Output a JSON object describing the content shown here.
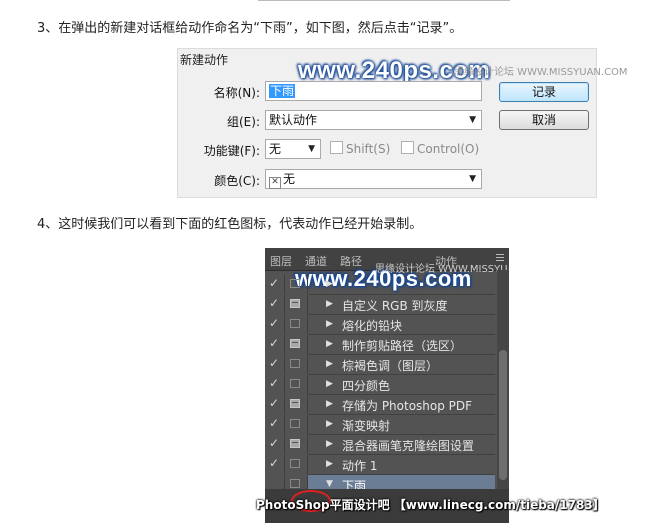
{
  "step3": {
    "text": "3、在弹出的新建对话框给动作命名为“下雨”，如下图，然后点击“记录”。"
  },
  "dialog": {
    "title": "新建动作",
    "watermark_main": "www.240ps.com",
    "watermark_sub": "思缘设计论坛  WWW.MISSYUAN.COM",
    "name_label": "名称(N):",
    "name_value": "下雨",
    "set_label": "组(E):",
    "set_value": "默认动作",
    "fkey_label": "功能键(F):",
    "fkey_value": "无",
    "shift_label": "Shift(S)",
    "control_label": "Control(O)",
    "color_label": "颜色(C):",
    "color_value": "无",
    "record_button": "记录",
    "cancel_button": "取消"
  },
  "step4": {
    "text": "4、这时候我们可以看到下面的红色图标，代表动作已经开始录制。"
  },
  "panel": {
    "tabs": [
      "图层",
      "通道",
      "路径",
      "动作"
    ],
    "watermark_main": "www.240ps.com",
    "watermark_sub": "思缘设计论坛 WWW.MISSYUAN.COM",
    "rows": [
      {
        "label": "",
        "checked": true,
        "dialog_on": false,
        "expander": "▶"
      },
      {
        "label": "自定义 RGB 到灰度",
        "checked": true,
        "dialog_on": true,
        "expander": "▶"
      },
      {
        "label": "熔化的铅块",
        "checked": true,
        "dialog_on": false,
        "expander": "▶"
      },
      {
        "label": "制作剪贴路径（选区）",
        "checked": true,
        "dialog_on": true,
        "expander": "▶"
      },
      {
        "label": "棕褐色调（图层）",
        "checked": true,
        "dialog_on": false,
        "expander": "▶"
      },
      {
        "label": "四分颜色",
        "checked": true,
        "dialog_on": false,
        "expander": "▶"
      },
      {
        "label": "存储为 Photoshop PDF",
        "checked": true,
        "dialog_on": true,
        "expander": "▶"
      },
      {
        "label": "渐变映射",
        "checked": true,
        "dialog_on": false,
        "expander": "▶"
      },
      {
        "label": "混合器画笔克隆绘图设置",
        "checked": true,
        "dialog_on": true,
        "expander": "▶"
      },
      {
        "label": "动作 1",
        "checked": true,
        "dialog_on": false,
        "expander": "▶"
      },
      {
        "label": "下雨",
        "checked": false,
        "dialog_on": false,
        "expander": "▼",
        "selected": true
      }
    ]
  },
  "footer_watermark": "PhotoShop平面设计吧 【www.linecg.com/tieba/1783】",
  "colors": {
    "accent_highlight": "#3399ff",
    "panel_bg": "#535353",
    "record_ring": "#e02020"
  }
}
